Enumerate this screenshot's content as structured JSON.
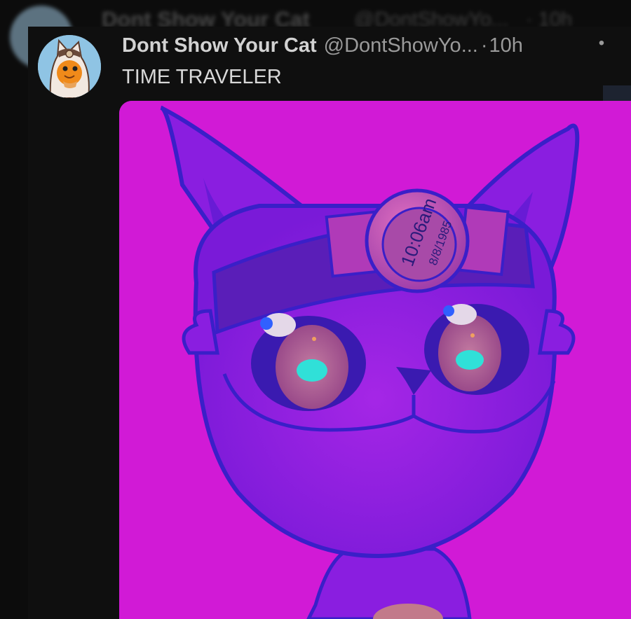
{
  "tweet": {
    "display_name": "Dont Show Your Cat",
    "handle": "@DontShowYo...",
    "separator": "·",
    "time": "10h",
    "more_icon": "more-dots-icon",
    "text": "TIME TRAVELER"
  },
  "ghost_header": {
    "display_name": "Dont Show Your Cat",
    "handle": "@DontShowYo...",
    "time": "· 10h"
  },
  "media": {
    "watch_time": "10:06am",
    "watch_date": "8/8/1985"
  },
  "colors": {
    "background": "#0c0c0c",
    "media_background": "#d11ad6",
    "outline": "#3a1fc8",
    "avatar_background": "#8fc4e4"
  }
}
